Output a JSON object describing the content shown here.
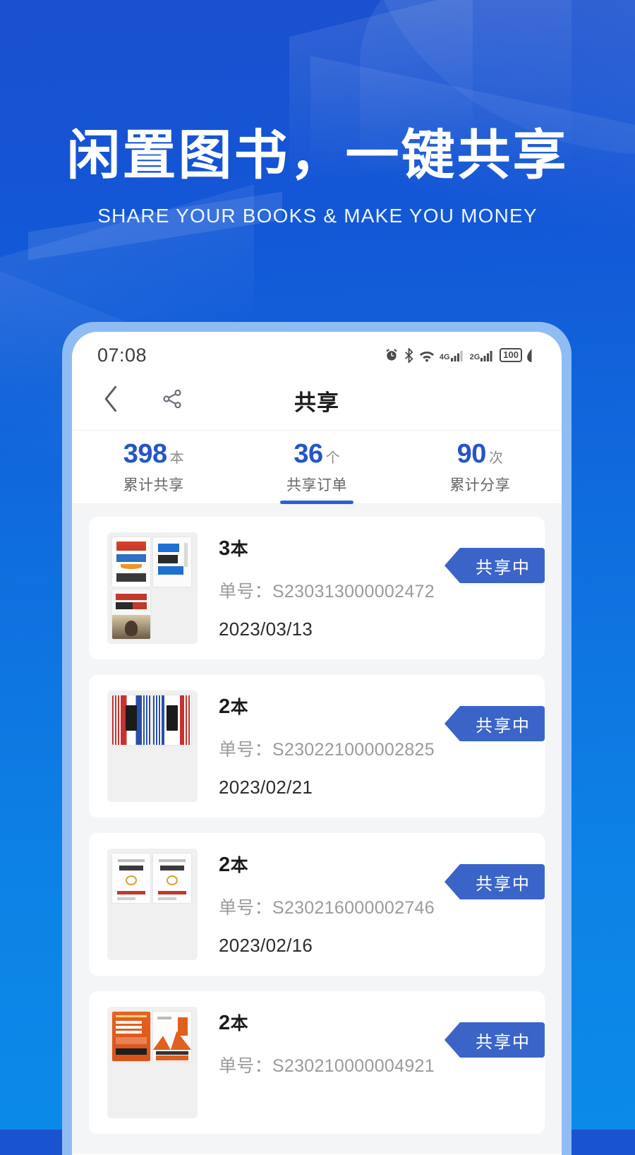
{
  "hero": {
    "title": "闲置图书，一键共享",
    "subtitle": "SHARE YOUR BOOKS & MAKE YOU MONEY"
  },
  "status_bar": {
    "time": "07:08",
    "icons": [
      "alarm-icon",
      "bluetooth-icon",
      "wifi-icon",
      "signal-4g-icon",
      "signal-2g-icon",
      "battery-icon",
      "leaf-icon"
    ],
    "signal_1_label": "4G",
    "signal_2_label": "2G",
    "battery_level": "100"
  },
  "header": {
    "back_icon": "chevron-left-icon",
    "share_icon": "share-icon",
    "title": "共享"
  },
  "stats": [
    {
      "value": "398",
      "unit": "本",
      "label": "累计共享",
      "active": false
    },
    {
      "value": "36",
      "unit": "个",
      "label": "共享订单",
      "active": true
    },
    {
      "value": "90",
      "unit": "次",
      "label": "累计分享",
      "active": false
    }
  ],
  "order_labels": {
    "order_no_prefix": "单号：",
    "count_unit": "本"
  },
  "orders": [
    {
      "count": "3",
      "count_unit": "本",
      "order_no_label": "单号：",
      "order_no": "S230313000002472",
      "date": "2023/03/13",
      "status": "共享中",
      "covers": [
        "bezos-letters-cover",
        "huawei-grey-management-cover",
        "team-leadership-cover"
      ]
    },
    {
      "count": "2",
      "count_unit": "本",
      "order_no_label": "单号：",
      "order_no": "S230221000002825",
      "date": "2023/02/21",
      "status": "共享中",
      "covers": [
        "cognitive-awakening-cover",
        "cognitive-drive-cover"
      ]
    },
    {
      "count": "2",
      "count_unit": "本",
      "order_no_label": "单号：",
      "order_no": "S230216000002746",
      "date": "2023/02/16",
      "status": "共享中",
      "covers": [
        "plain-white-cover-1",
        "plain-white-cover-2"
      ]
    },
    {
      "count": "2",
      "count_unit": "本",
      "order_no_label": "单号：",
      "order_no": "S230210000004921",
      "date": "",
      "status": "共享中",
      "covers": [
        "sales-acceleration-formula-cover",
        "crossing-the-chasm-cover"
      ]
    }
  ],
  "colors": {
    "background_top": "#1b50ce",
    "background_bottom": "#0b8ae9",
    "phone_frame": "#8fbcf3",
    "accent_blue": "#2356c8",
    "ribbon_blue": "#3b64c9",
    "tab_indicator": "#2d5fd4"
  }
}
